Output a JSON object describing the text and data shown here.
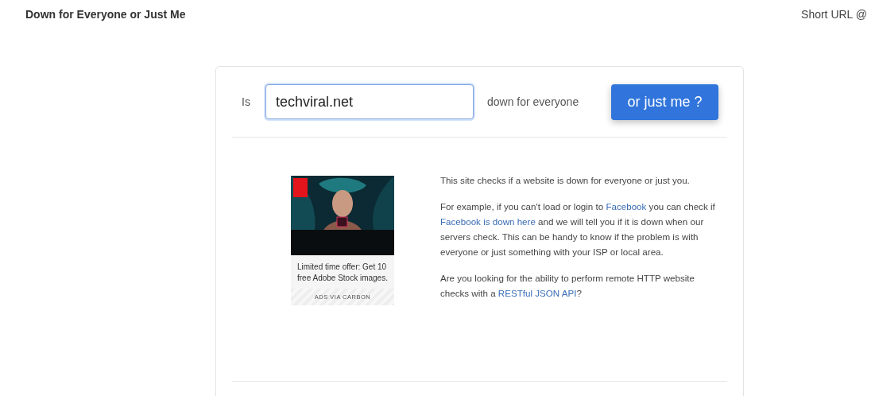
{
  "header": {
    "title": "Down for Everyone or Just Me",
    "short_url": "Short URL @"
  },
  "form": {
    "prefix": "Is",
    "value": "techviral.net",
    "suffix": "down for everyone",
    "button": "or just me ?"
  },
  "ad": {
    "text": "Limited time offer: Get 10 free Adobe Stock images.",
    "footer": "ADS VIA CARBON"
  },
  "about": [
    [
      {
        "text": "This site checks if a website is down for everyone or just you.",
        "link": false
      }
    ],
    [
      {
        "text": "For example, if you can't load or login to ",
        "link": false
      },
      {
        "text": "Facebook",
        "link": true
      },
      {
        "text": " you can check if ",
        "link": false
      },
      {
        "text": "Facebook is down here",
        "link": true
      },
      {
        "text": " and we will tell you if it is down when our servers check. This can be handy to know if the problem is with everyone or just something with your ISP or local area.",
        "link": false
      }
    ],
    [
      {
        "text": "Are you looking for the ability to perform remote HTTP website checks with a ",
        "link": false
      },
      {
        "text": "RESTful JSON API",
        "link": true
      },
      {
        "text": "?",
        "link": false
      }
    ]
  ]
}
